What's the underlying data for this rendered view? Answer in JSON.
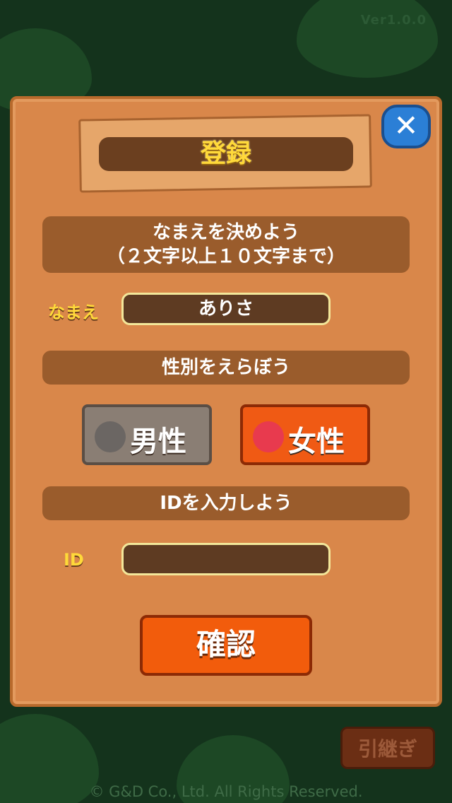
{
  "app": {
    "version": "Ver1.0.0",
    "copyright": "© G&D Co., Ltd. All Rights Reserved."
  },
  "dialog": {
    "title": "登録",
    "close_icon": "close-x-icon",
    "name_prompt_line1": "なまえを決めよう",
    "name_prompt_line2": "（２文字以上１０文字まで）",
    "name_label": "なまえ",
    "name_value": "ありさ",
    "gender_prompt": "性別をえらぼう",
    "gender_options": [
      {
        "label": "男性",
        "icon": "gray-bear-icon",
        "selected": false
      },
      {
        "label": "女性",
        "icon": "red-bear-icon",
        "selected": true
      }
    ],
    "id_prompt": "IDを入力しよう",
    "id_label": "ID",
    "id_value": "",
    "confirm_label": "確認"
  },
  "footer": {
    "handover_label": "引継ぎ"
  },
  "colors": {
    "panel": "#d9874a",
    "accent_orange": "#f25c0c",
    "title_yellow": "#ffd93a",
    "close_blue": "#2b7fd6"
  }
}
